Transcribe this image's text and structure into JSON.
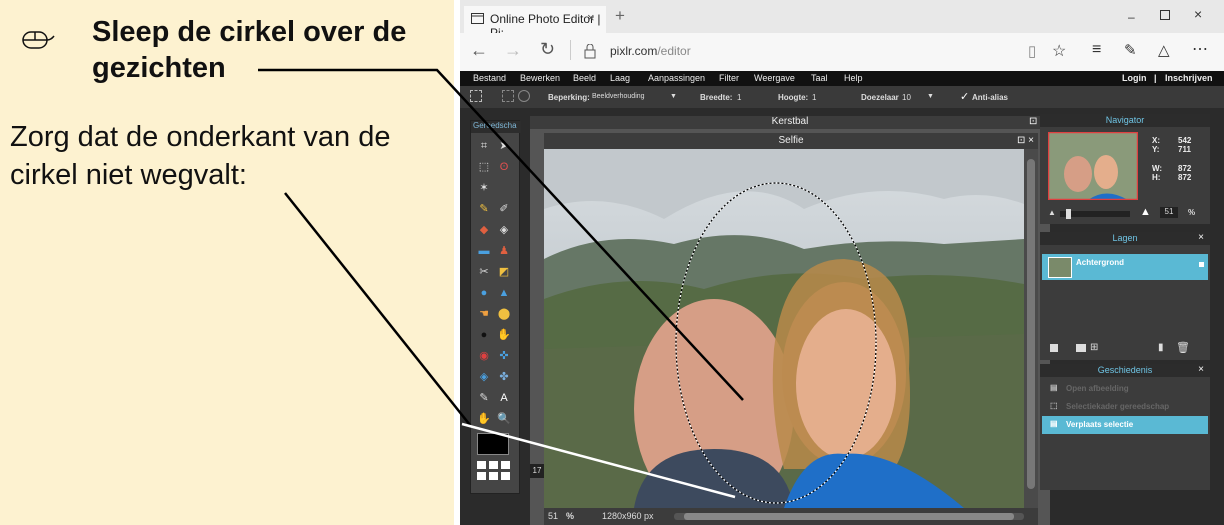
{
  "instruction": {
    "title": "Sleep de cirkel over de\ngezichten",
    "body": "Zorg dat de onderkant van de\ncirkel niet wegvalt:",
    "icon": "mouse-icon"
  },
  "browser": {
    "tab_title": "Online Photo Editor | Pi:",
    "url_host": "pixlr.com",
    "url_path": "/editor"
  },
  "app": {
    "menu": [
      "Bestand",
      "Bewerken",
      "Beeld",
      "Laag",
      "Aanpassingen",
      "Filter",
      "Weergave",
      "Taal",
      "Help"
    ],
    "login": "Login",
    "separator": "|",
    "register": "Inschrijven",
    "options": {
      "constraint_label": "Beperking:",
      "constraint_value": "Beeldverhouding",
      "width_label": "Breedte:",
      "width_value": "1",
      "height_label": "Hoogte:",
      "height_value": "1",
      "feather_label": "Doezelaar",
      "feather_value": "10",
      "antialias_label": "Anti-alias",
      "antialias_checked": true
    },
    "toolbox_title": "Gereedscha",
    "doc_behind_title": "Kerstbal",
    "doc_title": "Selfie",
    "zoom_value": "51",
    "zoom_unit": "%",
    "image_size": "1280x960 px",
    "side_number": "17"
  },
  "panels": {
    "navigator": {
      "title": "Navigator",
      "x_label": "X:",
      "x_value": "542",
      "y_label": "Y:",
      "y_value": "711",
      "w_label": "W:",
      "w_value": "872",
      "h_label": "H:",
      "h_value": "872",
      "zoom_value": "51",
      "zoom_unit": "%"
    },
    "layers": {
      "title": "Lagen",
      "items": [
        {
          "label": "Achtergrond",
          "locked": true
        }
      ]
    },
    "history": {
      "title": "Geschiedenis",
      "items": [
        {
          "label": "Open afbeelding",
          "state": "dim"
        },
        {
          "label": "Selectiekader gereedschap",
          "state": "dim"
        },
        {
          "label": "Verplaats selectie",
          "state": "active"
        }
      ]
    }
  },
  "colors": {
    "instruction_bg": "#fdf2d0",
    "accent": "#5ab9d4",
    "app_bg": "#2b2b2b"
  }
}
